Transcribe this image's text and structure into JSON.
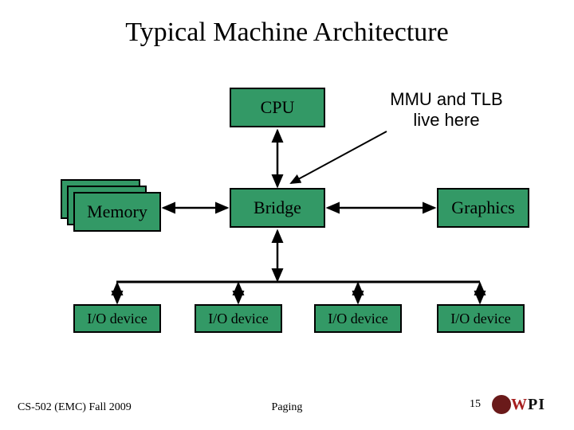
{
  "title": "Typical Machine Architecture",
  "blocks": {
    "cpu": "CPU",
    "memory": "Memory",
    "bridge": "Bridge",
    "graphics": "Graphics",
    "io": "I/O device"
  },
  "annotation": {
    "line1": "MMU and TLB",
    "line2": "live here"
  },
  "footer": {
    "left": "CS-502 (EMC) Fall 2009",
    "center": "Paging",
    "pageno": "15",
    "logo_text_w": "W",
    "logo_text_pi": "PI"
  },
  "colors": {
    "block_fill": "#339966"
  },
  "chart_data": {
    "type": "diagram",
    "title": "Typical Machine Architecture",
    "nodes": [
      {
        "id": "cpu",
        "label": "CPU"
      },
      {
        "id": "memory",
        "label": "Memory",
        "stacked": 3
      },
      {
        "id": "bridge",
        "label": "Bridge"
      },
      {
        "id": "graphics",
        "label": "Graphics"
      },
      {
        "id": "io1",
        "label": "I/O device"
      },
      {
        "id": "io2",
        "label": "I/O device"
      },
      {
        "id": "io3",
        "label": "I/O device"
      },
      {
        "id": "io4",
        "label": "I/O device"
      }
    ],
    "edges": [
      {
        "from": "cpu",
        "to": "bridge",
        "style": "double-arrow"
      },
      {
        "from": "memory",
        "to": "bridge",
        "style": "double-arrow"
      },
      {
        "from": "bridge",
        "to": "graphics",
        "style": "double-arrow"
      },
      {
        "from": "bridge",
        "to": "io-bus",
        "style": "double-arrow"
      },
      {
        "from": "io-bus",
        "to": "io1",
        "style": "double-arrow"
      },
      {
        "from": "io-bus",
        "to": "io2",
        "style": "double-arrow"
      },
      {
        "from": "io-bus",
        "to": "io3",
        "style": "double-arrow"
      },
      {
        "from": "io-bus",
        "to": "io4",
        "style": "double-arrow"
      }
    ],
    "annotations": [
      {
        "text": "MMU and TLB live here",
        "points_to": "cpu-bridge-edge"
      }
    ]
  }
}
